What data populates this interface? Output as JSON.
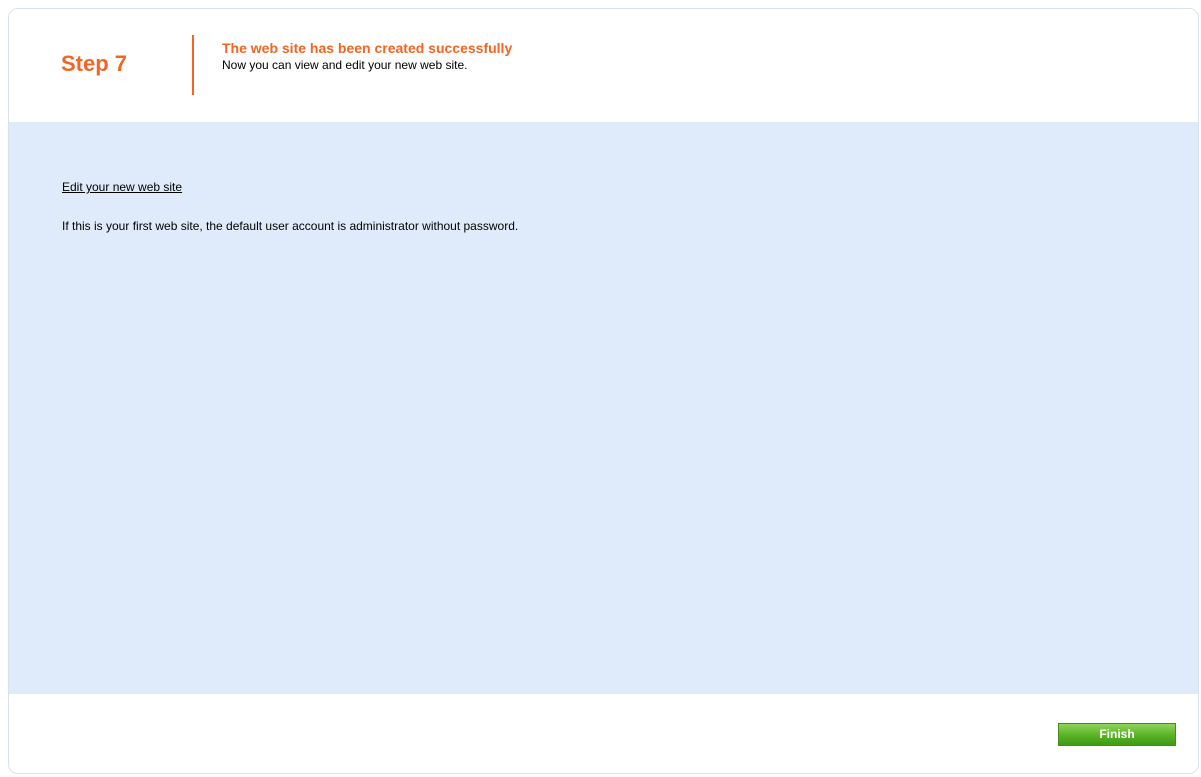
{
  "header": {
    "step_label": "Step 7",
    "title": "The web site has been created successfully",
    "subtitle": "Now you can view and edit your new web site."
  },
  "content": {
    "edit_link": "Edit your new web site",
    "info_text": "If this is your first web site, the default user account is administrator without password."
  },
  "footer": {
    "finish_label": "Finish"
  },
  "colors": {
    "accent": "#f26522",
    "content_bg": "#dfebfb",
    "button_green": "#5cb52a"
  }
}
